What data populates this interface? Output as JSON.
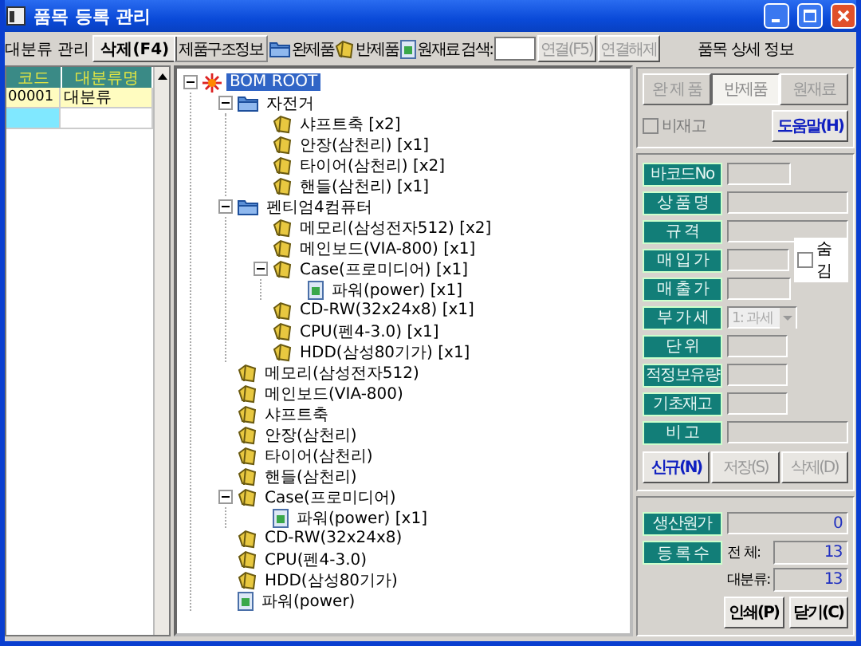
{
  "window": {
    "title": "품목 등록 관리"
  },
  "category_panel": {
    "title": "대분류 관리",
    "delete_button": "삭제(F4)",
    "columns": [
      "코드",
      "대분류명"
    ],
    "rows": [
      {
        "code": "00001",
        "name": "대분류",
        "selected": true
      }
    ],
    "new_row_focused": true
  },
  "structure_toolbar": {
    "title": "제품구조정보",
    "legend": [
      {
        "kind": "finished",
        "label": "완제품"
      },
      {
        "kind": "semi",
        "label": "반제품"
      },
      {
        "kind": "material",
        "label": "원재료"
      }
    ],
    "search_label": "검색:",
    "buttons": [
      {
        "label": "연결(F5)",
        "disabled": true
      },
      {
        "label": "연결해제",
        "disabled": true
      }
    ]
  },
  "tree": {
    "nodes": [
      {
        "kind": "root",
        "label": "BOM ROOT",
        "selected": true,
        "expanded": true,
        "children": [
          {
            "kind": "finished",
            "label": "자전거",
            "selected": false,
            "expanded": true,
            "children": [
              {
                "kind": "semi",
                "label": "샤프트축 [x2]",
                "selected": false
              },
              {
                "kind": "semi",
                "label": "안장(삼천리) [x1]",
                "selected": false
              },
              {
                "kind": "semi",
                "label": "타이어(삼천리) [x2]",
                "selected": false
              },
              {
                "kind": "semi",
                "label": "핸들(삼천리) [x1]",
                "selected": false
              }
            ]
          },
          {
            "kind": "finished",
            "label": "펜티엄4컴퓨터",
            "selected": false,
            "expanded": true,
            "children": [
              {
                "kind": "semi",
                "label": "메모리(삼성전자512) [x2]",
                "selected": false
              },
              {
                "kind": "semi",
                "label": "메인보드(VIA-800) [x1]",
                "selected": false
              },
              {
                "kind": "semi",
                "label": "Case(프로미디어) [x1]",
                "selected": false,
                "expanded": true,
                "children": [
                  {
                    "kind": "material",
                    "label": "파워(power) [x1]",
                    "selected": false
                  }
                ]
              },
              {
                "kind": "semi",
                "label": "CD-RW(32x24x8) [x1]",
                "selected": false
              },
              {
                "kind": "semi",
                "label": "CPU(펜4-3.0) [x1]",
                "selected": false
              },
              {
                "kind": "semi",
                "label": "HDD(삼성80기가) [x1]",
                "selected": false
              }
            ]
          },
          {
            "kind": "semi",
            "label": "메모리(삼성전자512)",
            "selected": false
          },
          {
            "kind": "semi",
            "label": "메인보드(VIA-800)",
            "selected": false
          },
          {
            "kind": "semi",
            "label": "샤프트축",
            "selected": false
          },
          {
            "kind": "semi",
            "label": "안장(삼천리)",
            "selected": false
          },
          {
            "kind": "semi",
            "label": "타이어(삼천리)",
            "selected": false
          },
          {
            "kind": "semi",
            "label": "핸들(삼천리)",
            "selected": false
          },
          {
            "kind": "semi",
            "label": "Case(프로미디어)",
            "selected": false,
            "expanded": true,
            "children": [
              {
                "kind": "material",
                "label": "파워(power) [x1]",
                "selected": false
              }
            ]
          },
          {
            "kind": "semi",
            "label": "CD-RW(32x24x8)",
            "selected": false
          },
          {
            "kind": "semi",
            "label": "CPU(펜4-3.0)",
            "selected": false
          },
          {
            "kind": "semi",
            "label": "HDD(삼성80기가)",
            "selected": false
          },
          {
            "kind": "material",
            "label": "파워(power)",
            "selected": false
          }
        ]
      }
    ]
  },
  "detail_panel": {
    "title": "품목 상세 정보",
    "tabs": [
      {
        "label": "완 제 품",
        "selected": false
      },
      {
        "label": "반제품",
        "selected": true
      },
      {
        "label": "원재료",
        "selected": false
      }
    ],
    "non_stock": {
      "label": "비재고",
      "checked": false,
      "disabled": true
    },
    "help_button": "도움말(H)",
    "fields": [
      {
        "label": "바코드No",
        "kind": "medium"
      },
      {
        "label": "상 품 명",
        "kind": "long"
      },
      {
        "label": "규 격",
        "kind": "long"
      },
      {
        "label": "매 입 가",
        "kind": "medium",
        "checkbox": {
          "label": "숨김",
          "checked": false
        }
      },
      {
        "label": "매 출 가",
        "kind": "medium"
      },
      {
        "label": "부 가 세",
        "kind": "select",
        "value": "1: 과세"
      },
      {
        "label": "단 위",
        "kind": "short"
      },
      {
        "label": "적정보유량",
        "kind": "short"
      },
      {
        "label": "기초재고",
        "kind": "short"
      },
      {
        "label": "비 고",
        "kind": "long"
      }
    ],
    "actions": [
      {
        "label": "신규(N)",
        "disabled": false
      },
      {
        "label": "저장(S)",
        "disabled": true
      },
      {
        "label": "삭제(D)",
        "disabled": true
      }
    ],
    "cost": {
      "label": "생산원가",
      "value": "0"
    },
    "count": {
      "label": "등 록 수",
      "total_label": "전 체:",
      "total": "13",
      "category_label": "대분류:",
      "category": "13"
    },
    "bottom_buttons": [
      "인쇄(P)",
      "닫기(C)"
    ]
  }
}
